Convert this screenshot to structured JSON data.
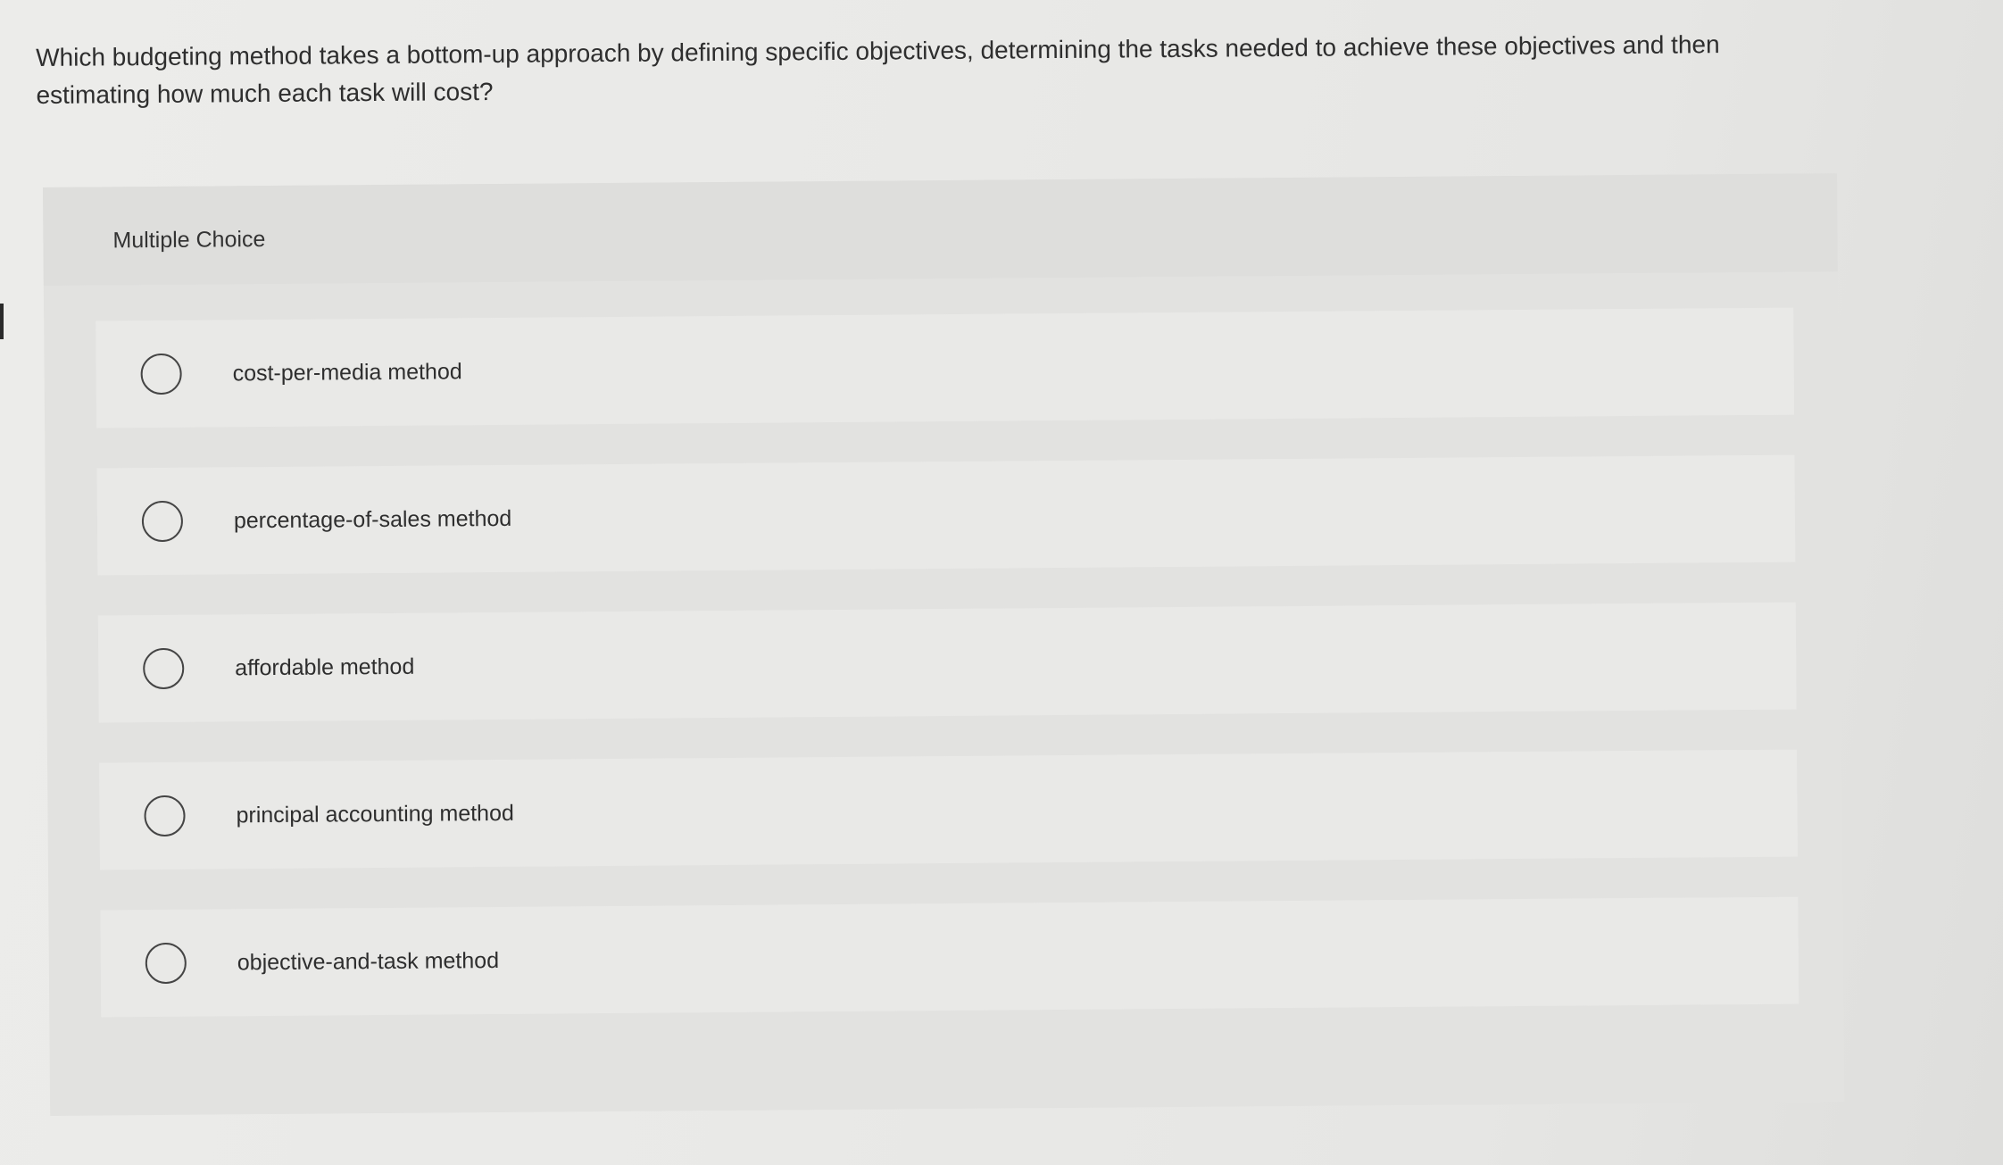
{
  "question": {
    "text": "Which budgeting method takes a bottom-up approach by defining specific objectives, determining the tasks needed to achieve these objectives and then estimating how much each task will cost?"
  },
  "panel": {
    "label": "Multiple Choice"
  },
  "choices": [
    {
      "label": "cost-per-media method",
      "selected": false
    },
    {
      "label": "percentage-of-sales method",
      "selected": false
    },
    {
      "label": "affordable method",
      "selected": false
    },
    {
      "label": "principal accounting method",
      "selected": false
    },
    {
      "label": "objective-and-task method",
      "selected": false
    }
  ]
}
